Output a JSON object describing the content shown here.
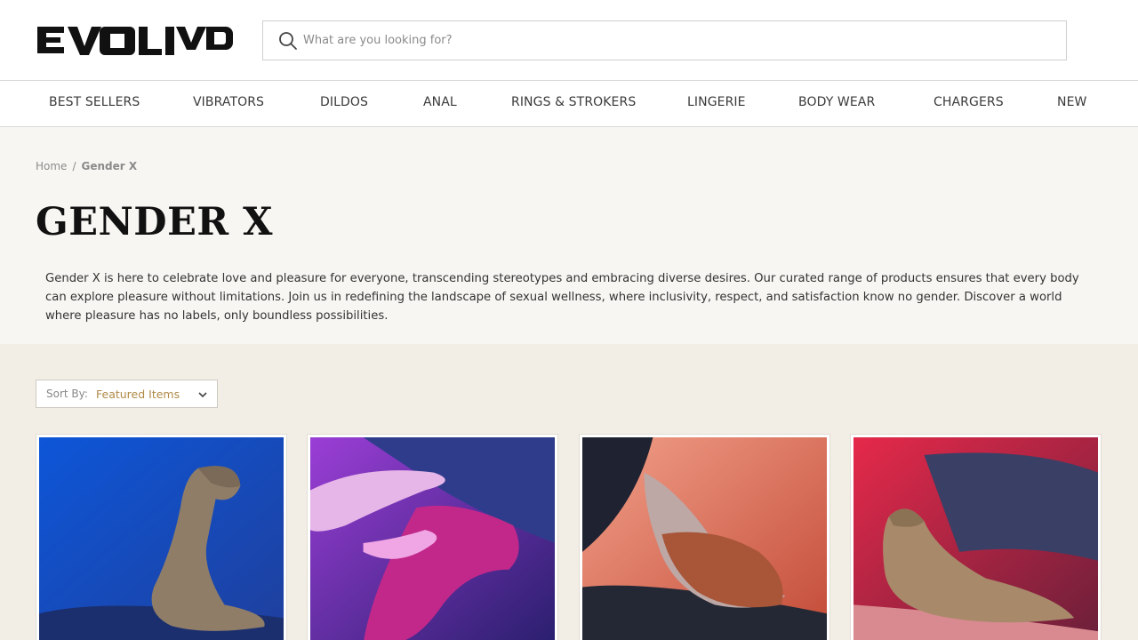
{
  "header": {
    "logo_text": "EVOLVED",
    "search": {
      "placeholder": "What are you looking for?",
      "value": ""
    }
  },
  "nav": {
    "items": [
      {
        "label": "BEST SELLERS"
      },
      {
        "label": "VIBRATORS"
      },
      {
        "label": "DILDOS"
      },
      {
        "label": "ANAL"
      },
      {
        "label": "RINGS & STROKERS"
      },
      {
        "label": "LINGERIE"
      },
      {
        "label": "BODY WEAR"
      },
      {
        "label": "CHARGERS"
      },
      {
        "label": "NEW"
      }
    ]
  },
  "breadcrumb": {
    "home": "Home",
    "separator": "/",
    "current": "Gender X"
  },
  "page": {
    "title": "GENDER X",
    "description": "Gender X is here to celebrate love and pleasure for everyone, transcending stereotypes and embracing diverse desires. Our curated range of products ensures that every body can explore pleasure without limitations. Join us in redefining the landscape of sexual wellness, where inclusivity, respect, and satisfaction know no gender. Discover a world where pleasure has no labels, only boundless possibilities."
  },
  "sort": {
    "label": "Sort By:",
    "value": "Featured Items"
  },
  "colors": {
    "accent": "#b08a47",
    "hero_bg": "#f7f6f3",
    "listing_bg": "#f2eee6",
    "text": "#333333"
  },
  "products": [
    {
      "image": "product-image-blue-background"
    },
    {
      "image": "product-image-purple-background"
    },
    {
      "image": "product-image-salmon-background"
    },
    {
      "image": "product-image-red-background"
    }
  ]
}
